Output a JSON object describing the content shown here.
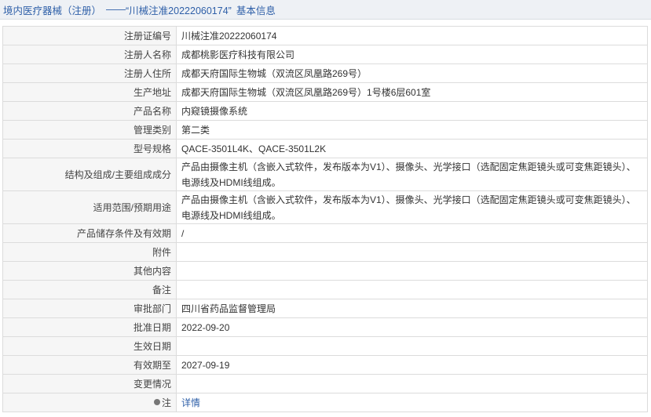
{
  "header": {
    "prefix": "境内医疗器械（注册）",
    "dash": "——",
    "record_title": "“川械注准20222060174”",
    "suffix": "基本信息"
  },
  "rows": [
    {
      "label": "注册证编号",
      "value": "川械注准20222060174"
    },
    {
      "label": "注册人名称",
      "value": "成都桃影医疗科技有限公司"
    },
    {
      "label": "注册人住所",
      "value": "成都天府国际生物城（双流区凤凰路269号）"
    },
    {
      "label": "生产地址",
      "value": "成都天府国际生物城（双流区凤凰路269号）1号楼6层601室"
    },
    {
      "label": "产品名称",
      "value": "内窥镜摄像系统"
    },
    {
      "label": "管理类别",
      "value": "第二类"
    },
    {
      "label": "型号规格",
      "value": "QACE-3501L4K、QACE-3501L2K"
    },
    {
      "label": "结构及组成/主要组成成分",
      "value": "产品由摄像主机（含嵌入式软件，发布版本为V1）、摄像头、光学接口（选配固定焦距镜头或可变焦距镜头）、电源线及HDMI线组成。"
    },
    {
      "label": "适用范围/预期用途",
      "value": "产品由摄像主机（含嵌入式软件，发布版本为V1）、摄像头、光学接口（选配固定焦距镜头或可变焦距镜头）、电源线及HDMI线组成。"
    },
    {
      "label": "产品储存条件及有效期",
      "value": "/"
    },
    {
      "label": "附件",
      "value": ""
    },
    {
      "label": "其他内容",
      "value": ""
    },
    {
      "label": "备注",
      "value": ""
    },
    {
      "label": "审批部门",
      "value": "四川省药品监督管理局"
    },
    {
      "label": "批准日期",
      "value": "2022-09-20"
    },
    {
      "label": "生效日期",
      "value": ""
    },
    {
      "label": "有效期至",
      "value": "2027-09-19"
    },
    {
      "label": "变更情况",
      "value": ""
    }
  ],
  "note_row": {
    "label": "注",
    "link_text": "详情"
  }
}
